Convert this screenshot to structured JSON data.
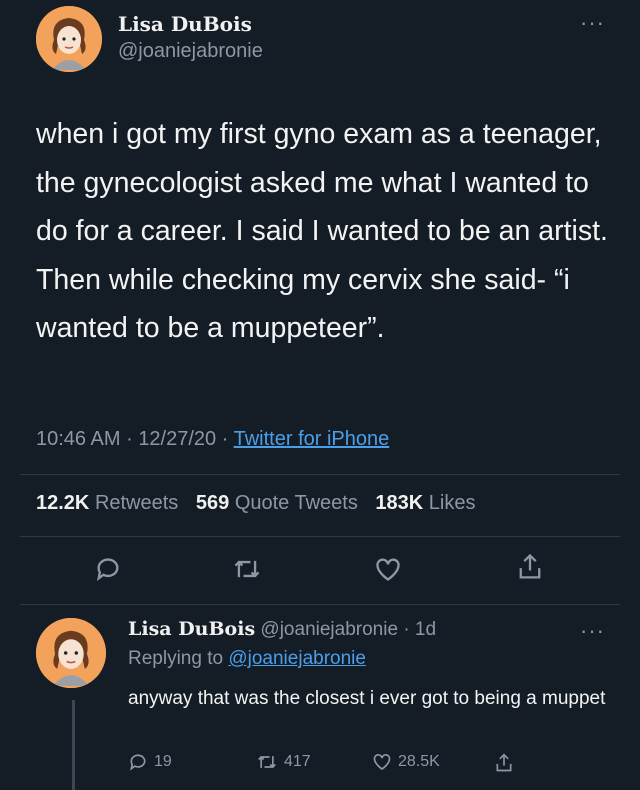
{
  "tweet": {
    "author_name": "Lisa DuBois",
    "handle": "@joaniejabronie",
    "more_icon": "more-dots-icon",
    "text": "when i got my first gyno exam as a teenager, the gynecologist asked me what I wanted to do for a career. I said I wanted to be an artist. Then while checking my cervix she said- “i wanted to be a muppeteer”.",
    "time": "10:46 AM",
    "date": "12/27/20",
    "separator": "·",
    "source": "Twitter for iPhone",
    "stats": {
      "retweets_count": "12.2K",
      "retweets_label": "Retweets",
      "quotes_count": "569",
      "quotes_label": "Quote Tweets",
      "likes_count": "183K",
      "likes_label": "Likes"
    },
    "actions": [
      "reply-icon",
      "retweet-icon",
      "like-icon",
      "share-icon"
    ]
  },
  "reply": {
    "author_name": "Lisa DuBois",
    "handle": "@joaniejabronie",
    "age": "· 1d",
    "replying_prefix": "Replying to",
    "replying_to": "@joaniejabronie",
    "text": "anyway that was the closest i ever got to being a muppet",
    "counts": {
      "replies": "19",
      "retweets": "417",
      "likes": "28.5K"
    }
  },
  "colors": {
    "background": "#141d26",
    "link": "#4a9fe8",
    "muted": "#8b98a5",
    "avatar_bg": "#f2a25a"
  }
}
